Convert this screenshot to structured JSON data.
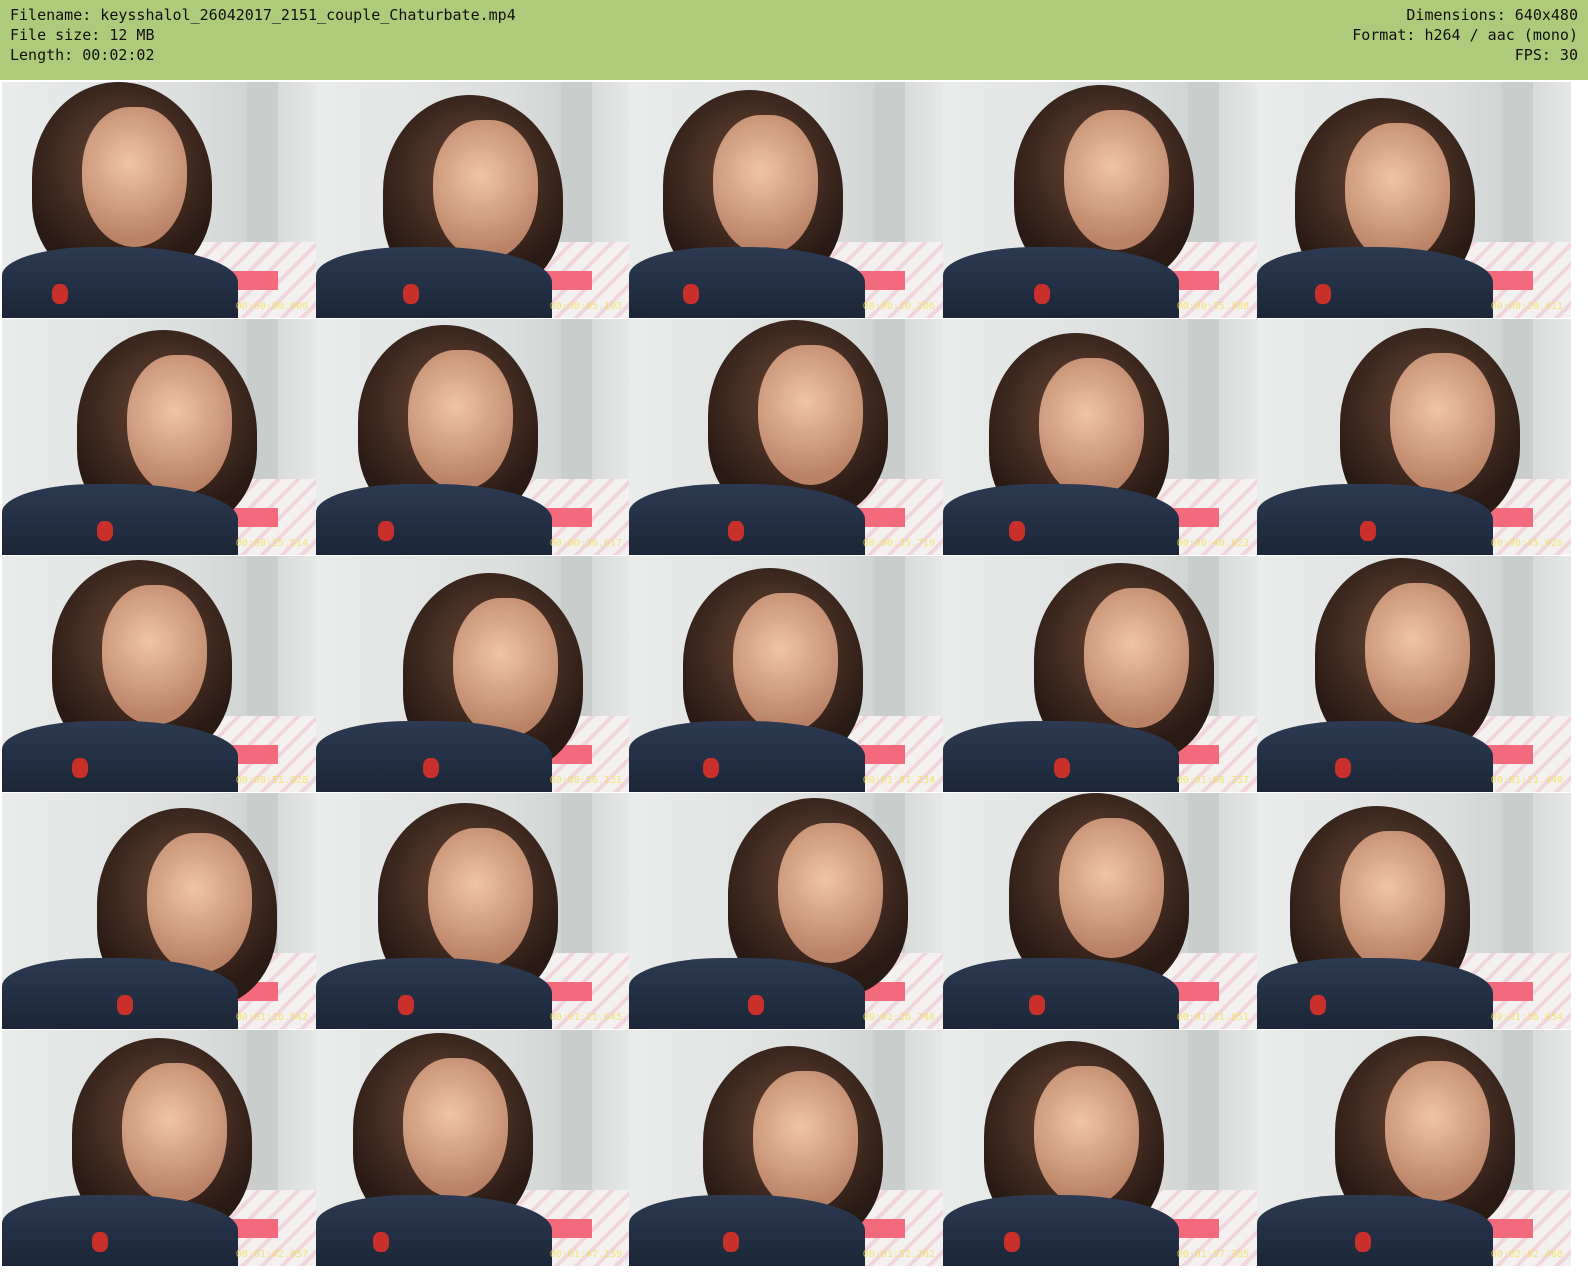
{
  "header": {
    "filename": "Filename: keysshalol_26042017_2151_couple_Chaturbate.mp4",
    "filesize": "File size: 12 MB",
    "length": "Length: 00:02:02",
    "dimensions": "Dimensions: 640x480",
    "format": "Format: h264 / aac (mono)",
    "fps": "FPS: 30"
  },
  "colors": {
    "header_bg": "#aecb7c"
  },
  "thumbnails": [
    {
      "timestamp": "00:00:00.000"
    },
    {
      "timestamp": "00:00:05.103"
    },
    {
      "timestamp": "00:00:10.206"
    },
    {
      "timestamp": "00:00:15.308"
    },
    {
      "timestamp": "00:00:20.411"
    },
    {
      "timestamp": "00:00:25.514"
    },
    {
      "timestamp": "00:00:30.617"
    },
    {
      "timestamp": "00:00:35.719"
    },
    {
      "timestamp": "00:00:40.823"
    },
    {
      "timestamp": "00:00:45.926"
    },
    {
      "timestamp": "00:00:51.028"
    },
    {
      "timestamp": "00:00:56.131"
    },
    {
      "timestamp": "00:01:01.234"
    },
    {
      "timestamp": "00:01:06.337"
    },
    {
      "timestamp": "00:01:11.440"
    },
    {
      "timestamp": "00:01:16.542"
    },
    {
      "timestamp": "00:01:21.645"
    },
    {
      "timestamp": "00:01:26.748"
    },
    {
      "timestamp": "00:01:31.851"
    },
    {
      "timestamp": "00:01:36.954"
    },
    {
      "timestamp": "00:01:42.057"
    },
    {
      "timestamp": "00:01:47.159"
    },
    {
      "timestamp": "00:01:52.262"
    },
    {
      "timestamp": "00:01:57.365"
    },
    {
      "timestamp": "00:02:02.468"
    }
  ]
}
